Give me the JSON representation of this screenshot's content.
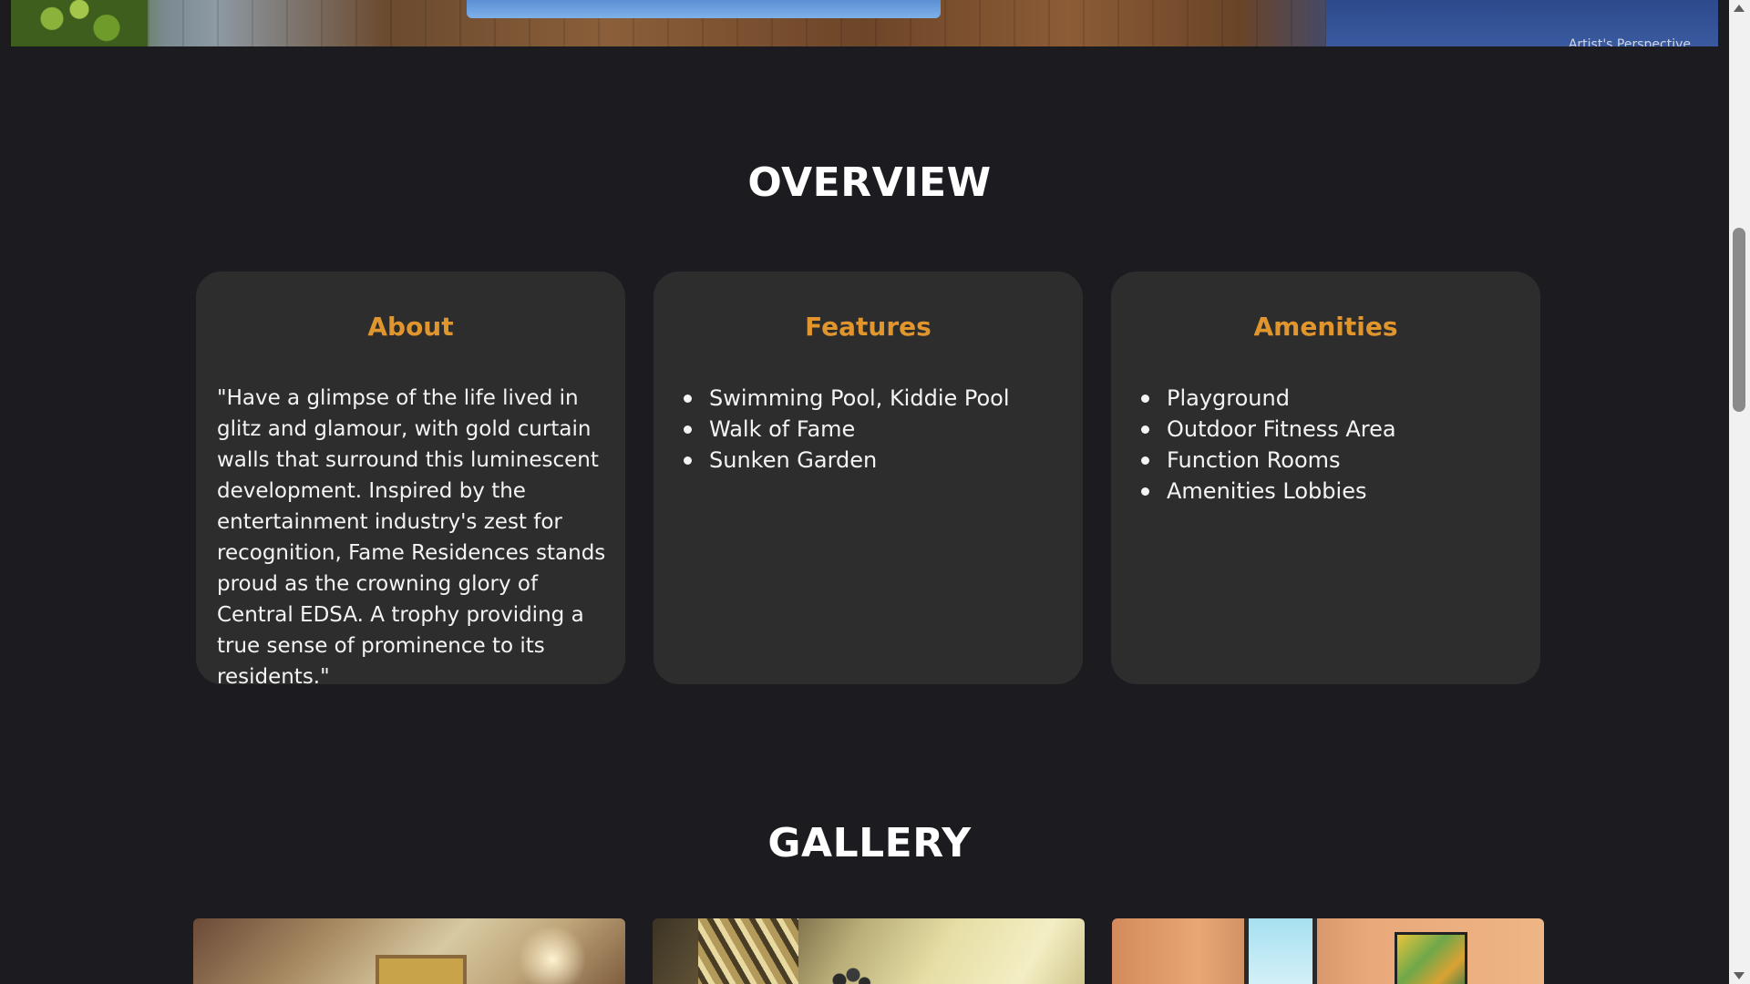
{
  "hero": {
    "caption": "Artist's Perspective"
  },
  "overview": {
    "title": "OVERVIEW",
    "cards": [
      {
        "title": "About",
        "text": "\"Have a glimpse of the life lived in glitz and glamour, with gold curtain walls that surround this luminescent development. Inspired by the entertainment industry's zest for recognition, Fame Residences stands proud as the crowning glory of Central EDSA. A trophy providing a true sense of prominence to its residents.\""
      },
      {
        "title": "Features",
        "items": [
          "Swimming Pool, Kiddie Pool",
          "Walk of Fame",
          "Sunken Garden"
        ]
      },
      {
        "title": "Amenities",
        "items": [
          "Playground",
          "Outdoor Fitness Area",
          "Function Rooms",
          "Amenities Lobbies"
        ]
      }
    ]
  },
  "gallery": {
    "title": "GALLERY"
  },
  "colors": {
    "background": "#1c1b20",
    "card": "#2e2d2d",
    "accent": "#e1962d",
    "text": "#ffffff"
  },
  "icons": {
    "scroll_up": "scroll-up-arrow-icon",
    "scroll_down": "scroll-down-arrow-icon",
    "bullet": "bullet-icon"
  }
}
